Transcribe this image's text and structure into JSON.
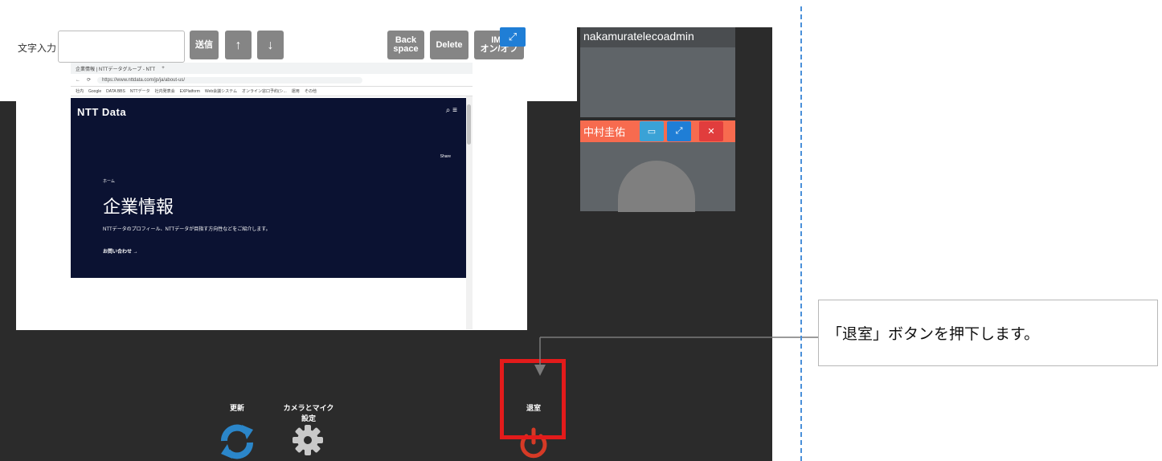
{
  "toolbar": {
    "input_label": "文字入力",
    "send_label": "送信",
    "up_label": "↑",
    "down_label": "↓",
    "backspace_label_1": "Back",
    "backspace_label_2": "space",
    "delete_label": "Delete",
    "ime_label_1": "IME",
    "ime_label_2": "オン/オフ"
  },
  "browser": {
    "tab_title": "企業情報 | NTTデータグループ - NTT",
    "new_tab": "+",
    "url": "https://www.nttdata.com/jp/ja/about-us/",
    "bookmarks": [
      "社内",
      "Google",
      "DATA BBS",
      "NTTデータ",
      "社内発表会",
      "EXPlatform",
      "Web会議システム",
      "オンライン窓口予約(シ...",
      "運用",
      "その他"
    ]
  },
  "site": {
    "logo": "NTT Data",
    "share": "Share",
    "crumb": "ホーム",
    "title": "企業情報",
    "subtitle": "NTTデータのプロフィール、NTTデータが目指す方向性などをご紹介します。",
    "contact": "お問い合わせ →"
  },
  "participants": {
    "admin_name": "nakamuratelecoadmin",
    "user_name": "中村圭佑"
  },
  "controls": {
    "refresh_label": "更新",
    "camera_mic_label_1": "カメラとマイク",
    "camera_mic_label_2": "設定",
    "exit_label": "退室"
  },
  "annotation": {
    "callout_text": "「退室」ボタンを押下します。"
  },
  "colors": {
    "app_bg": "#2b2b2b",
    "accent_blue": "#1f7ed6",
    "refresh_blue": "#2b86c9",
    "exit_red": "#d63a26",
    "highlight_red": "#e31b1b",
    "user_header": "#f76b4f"
  }
}
